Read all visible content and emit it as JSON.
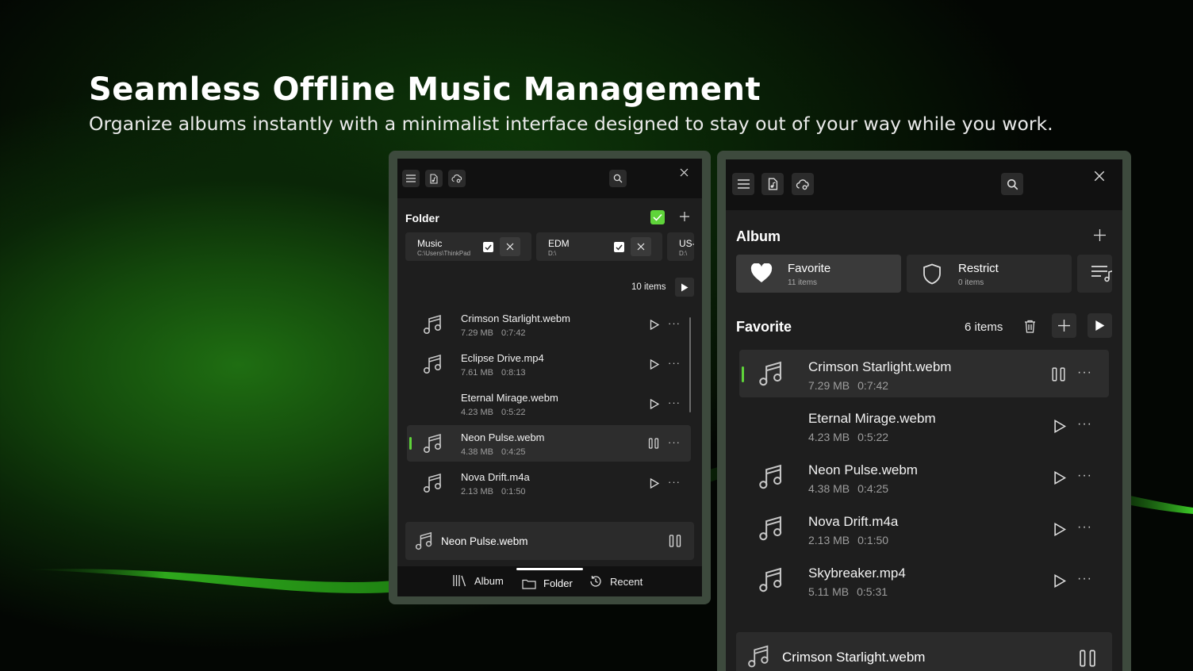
{
  "hero": {
    "title": "Seamless Offline Music Management",
    "subtitle": "Organize albums instantly with a minimalist interface designed to stay out of your way while you work."
  },
  "colors": {
    "accent": "#5fd43a",
    "window": "#1e1e1e",
    "topbar": "#111111",
    "frame": "#3d4a3d"
  },
  "left_window": {
    "toolbar": {
      "icons": [
        "menu-icon",
        "music-file-icon",
        "cloud-settings-icon",
        "search-icon",
        "close-icon"
      ]
    },
    "section_title": "Folder",
    "folders": [
      {
        "name": "Music",
        "path": "C:\\Users\\ThinkPad",
        "checked": true
      },
      {
        "name": "EDM",
        "path": "D:\\",
        "checked": true
      },
      {
        "name": "US-",
        "path": "D:\\"
      }
    ],
    "count": "10 items",
    "tracks": [
      {
        "name": "Crimson Starlight.webm",
        "size": "7.29 MB",
        "duration": "0:7:42",
        "has_icon": true,
        "playing": false
      },
      {
        "name": "Eclipse Drive.mp4",
        "size": "7.61 MB",
        "duration": "0:8:13",
        "has_icon": true,
        "playing": false
      },
      {
        "name": "Eternal Mirage.webm",
        "size": "4.23 MB",
        "duration": "0:5:22",
        "has_icon": false,
        "playing": false
      },
      {
        "name": "Neon Pulse.webm",
        "size": "4.38 MB",
        "duration": "0:4:25",
        "has_icon": true,
        "playing": true
      },
      {
        "name": "Nova Drift.m4a",
        "size": "2.13 MB",
        "duration": "0:1:50",
        "has_icon": true,
        "playing": false
      }
    ],
    "now_playing": "Neon Pulse.webm",
    "nav": {
      "album": "Album",
      "folder": "Folder",
      "recent": "Recent",
      "active": "folder"
    }
  },
  "right_window": {
    "toolbar": {
      "icons": [
        "menu-icon",
        "music-file-icon",
        "cloud-settings-icon",
        "search-icon",
        "close-icon"
      ]
    },
    "section_title": "Album",
    "albums": [
      {
        "name": "Favorite",
        "count": "11 items",
        "icon": "heart-icon",
        "selected": true
      },
      {
        "name": "Restrict",
        "count": "0 items",
        "icon": "shield-icon",
        "selected": false
      }
    ],
    "list_title": "Favorite",
    "count": "6 items",
    "tracks": [
      {
        "name": "Crimson Starlight.webm",
        "size": "7.29 MB",
        "duration": "0:7:42",
        "has_icon": true,
        "playing": true
      },
      {
        "name": "Eternal Mirage.webm",
        "size": "4.23 MB",
        "duration": "0:5:22",
        "has_icon": false,
        "playing": false
      },
      {
        "name": "Neon Pulse.webm",
        "size": "4.38 MB",
        "duration": "0:4:25",
        "has_icon": true,
        "playing": false
      },
      {
        "name": "Nova Drift.m4a",
        "size": "2.13 MB",
        "duration": "0:1:50",
        "has_icon": true,
        "playing": false
      },
      {
        "name": "Skybreaker.mp4",
        "size": "5.11 MB",
        "duration": "0:5:31",
        "has_icon": true,
        "playing": false
      }
    ],
    "now_playing": "Crimson Starlight.webm"
  }
}
